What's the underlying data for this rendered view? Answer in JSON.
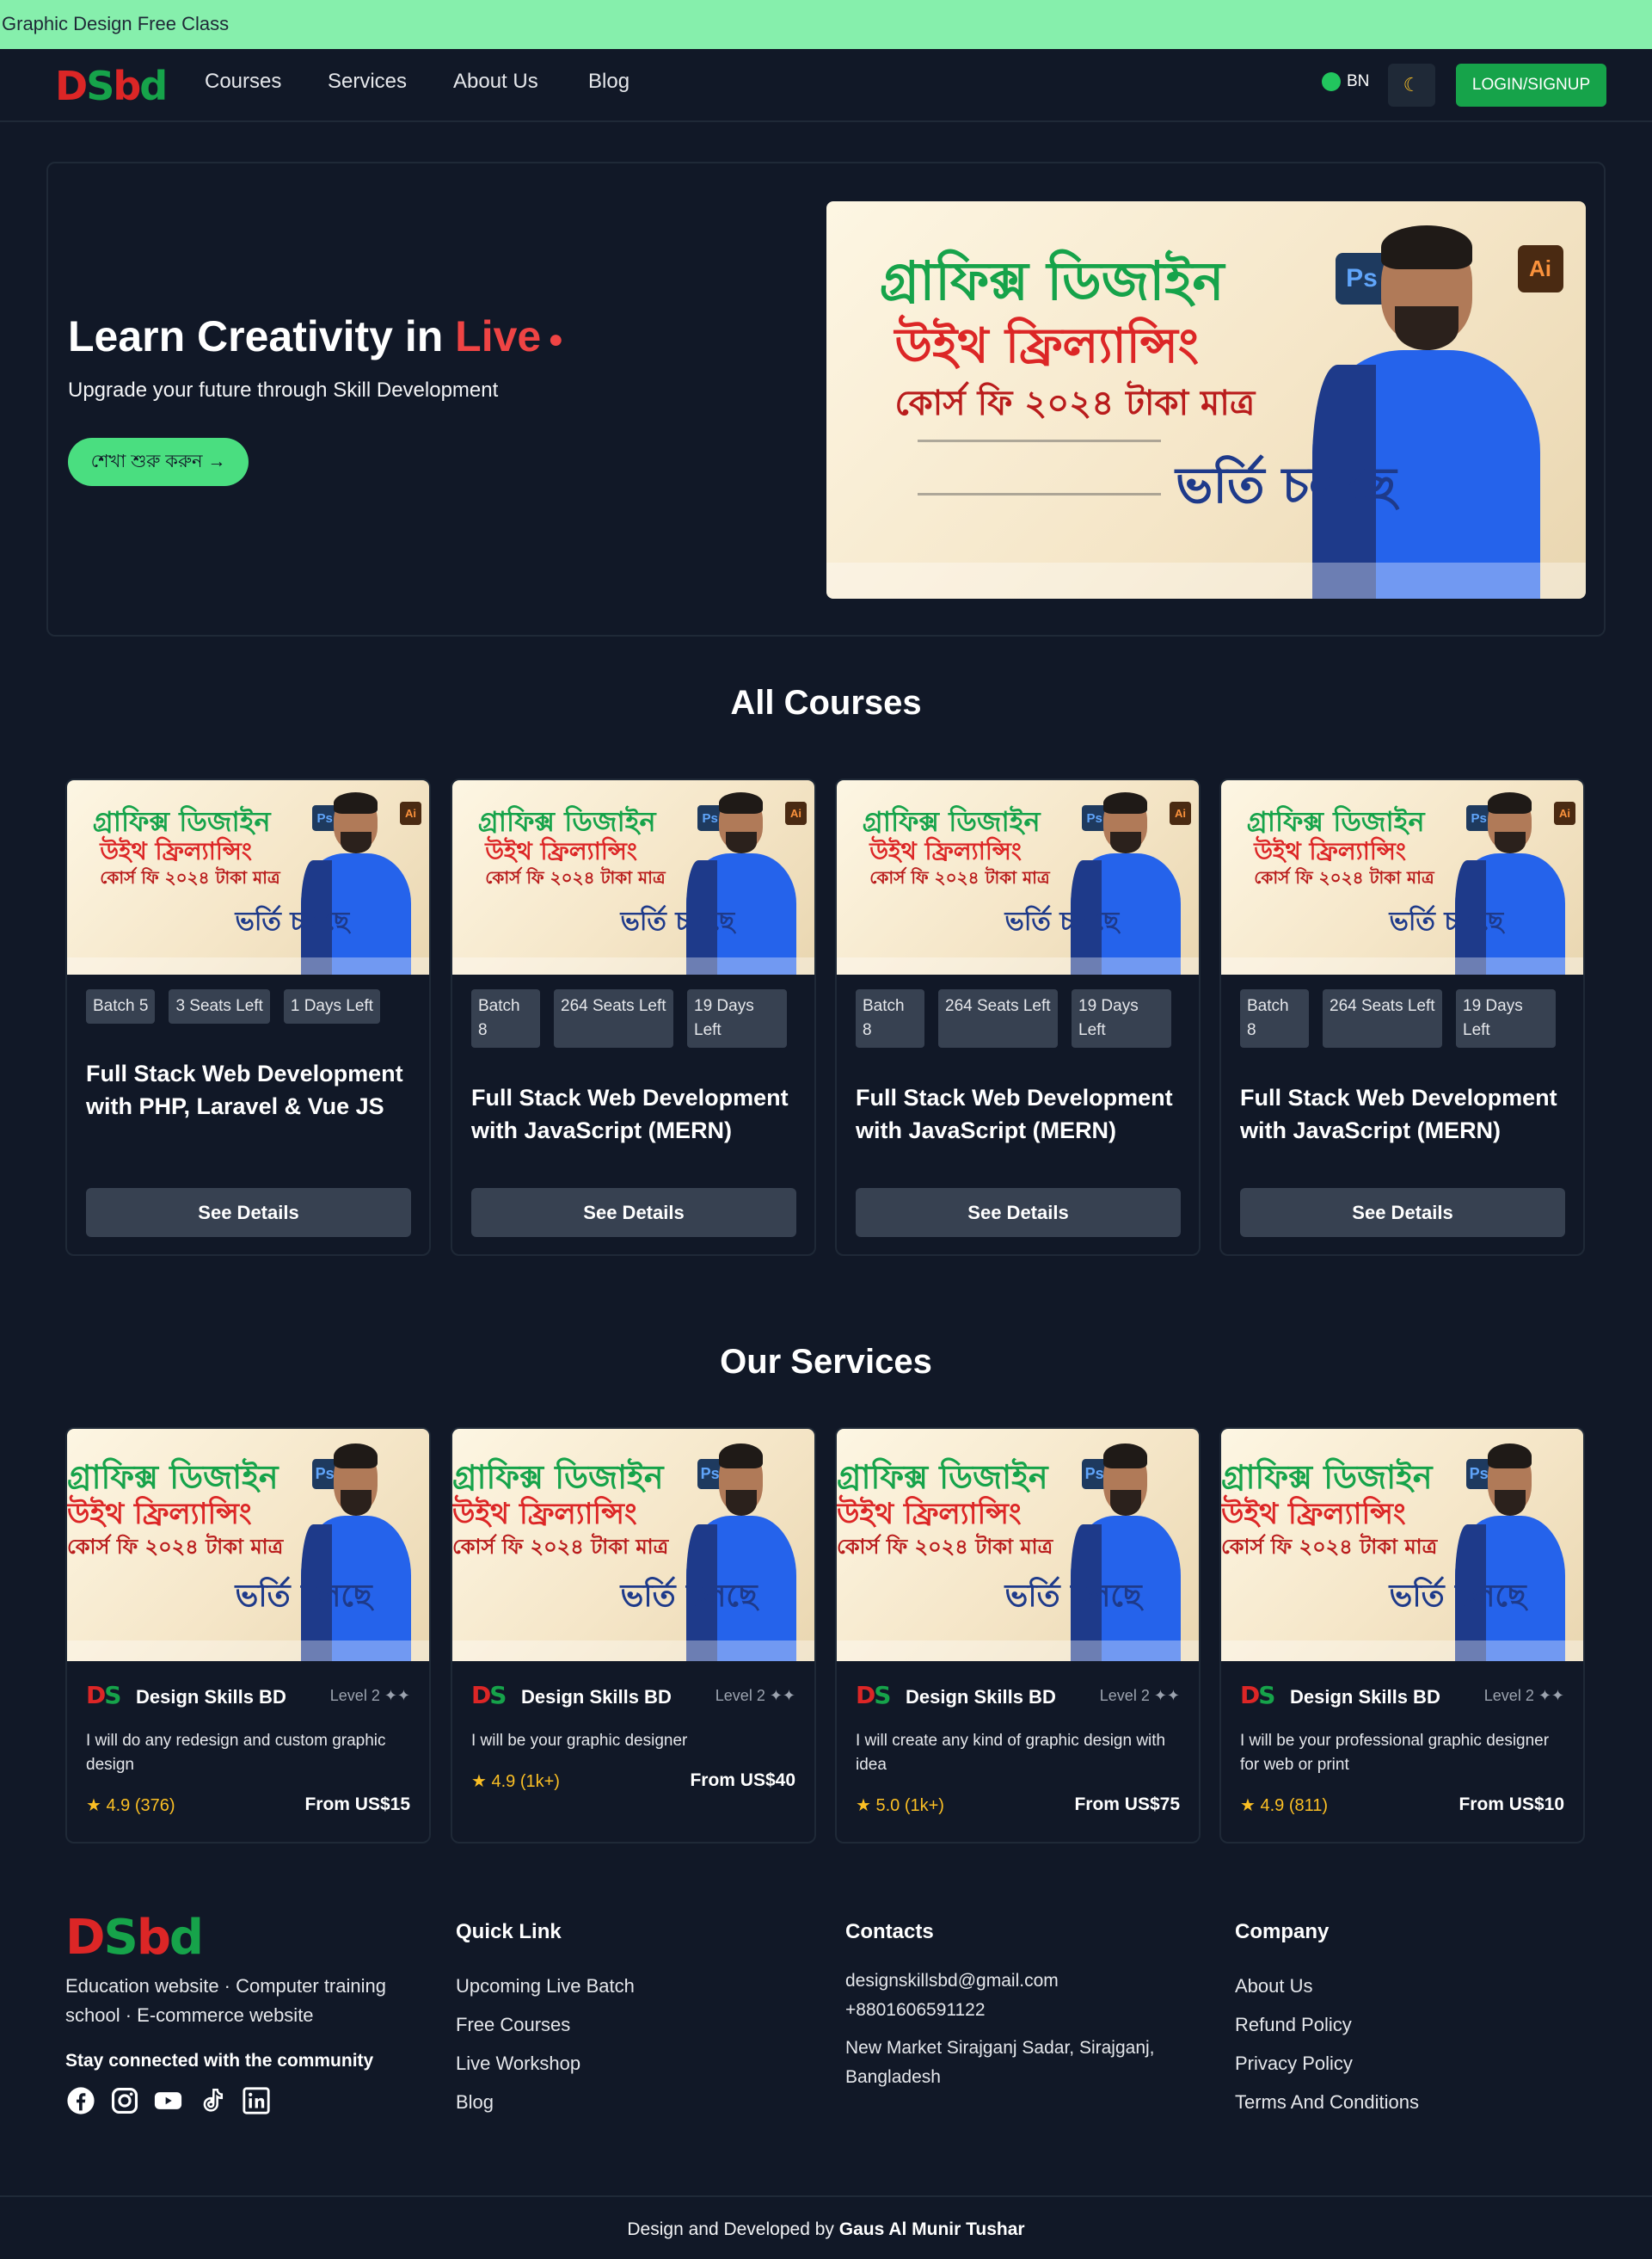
{
  "topbar": {
    "text": "Graphic Design Free Class"
  },
  "nav": {
    "logo": {
      "p1": "D",
      "p2": "S",
      "p3": "b",
      "p4": "d"
    },
    "links": [
      "Courses",
      "Services",
      "About Us",
      "Blog"
    ],
    "lang": "BN",
    "theme_icon": "moon-icon",
    "login": "LOGIN/SIGNUP"
  },
  "hero": {
    "title_prefix": "Learn Creativity in ",
    "title_live": "Live",
    "subtitle": "Upgrade your future through Skill Development",
    "cta": "শেখা শুরু করুন →"
  },
  "poster": {
    "line1": "গ্রাফিক্স ডিজাইন",
    "line2": "উইথ ফ্রিল্যান্সিং",
    "line3": "কোর্স ফি ২০২৪ টাকা মাত্র",
    "line4": "ভর্তি চলছে",
    "ps": "Ps",
    "ai": "Ai"
  },
  "courses_section": {
    "title": "All Courses",
    "cards": [
      {
        "badges": [
          "Batch 5",
          "3 Seats Left",
          "1 Days Left"
        ],
        "title": "Full Stack Web Development with PHP, Laravel & Vue JS",
        "button": "See Details"
      },
      {
        "badges": [
          "Batch 8",
          "264 Seats Left",
          "19 Days Left"
        ],
        "title": "Full Stack Web Development with JavaScript (MERN)",
        "button": "See Details"
      },
      {
        "badges": [
          "Batch 8",
          "264 Seats Left",
          "19 Days Left"
        ],
        "title": "Full Stack Web Development with JavaScript (MERN)",
        "button": "See Details"
      },
      {
        "badges": [
          "Batch 8",
          "264 Seats Left",
          "19 Days Left"
        ],
        "title": "Full Stack Web Development with JavaScript (MERN)",
        "button": "See Details"
      }
    ]
  },
  "services_section": {
    "title": "Our Services",
    "cards": [
      {
        "seller": "Design Skills BD",
        "level": "Level 2 ✦✦",
        "desc": "I will do any redesign and custom graphic design",
        "rating": "★ 4.9 (376)",
        "price": "From US$15"
      },
      {
        "seller": "Design Skills BD",
        "level": "Level 2 ✦✦",
        "desc": "I will be your graphic designer",
        "rating": "★ 4.9 (1k+)",
        "price": "From US$40"
      },
      {
        "seller": "Design Skills BD",
        "level": "Level 2 ✦✦",
        "desc": "I will create any kind of graphic design with idea",
        "rating": "★ 5.0 (1k+)",
        "price": "From US$75"
      },
      {
        "seller": "Design Skills BD",
        "level": "Level 2 ✦✦",
        "desc": "I will be your professional graphic designer for web or print",
        "rating": "★ 4.9 (811)",
        "price": "From US$10"
      }
    ]
  },
  "footer": {
    "tagline": "Education website · Computer training school · E-commerce website",
    "stay": "Stay connected with the community",
    "socials": [
      "facebook-icon",
      "instagram-icon",
      "youtube-icon",
      "tiktok-icon",
      "linkedin-icon"
    ],
    "quick_link": {
      "title": "Quick Link",
      "items": [
        "Upcoming Live Batch",
        "Free Courses",
        "Live Workshop",
        "Blog"
      ]
    },
    "contacts": {
      "title": "Contacts",
      "email": "designskillsbd@gmail.com",
      "phone": "+8801606591122",
      "address": "New Market Sirajganj Sadar, Sirajganj, Bangladesh"
    },
    "company": {
      "title": "Company",
      "items": [
        "About Us",
        "Refund Policy",
        "Privacy Policy",
        "Terms And Conditions"
      ]
    },
    "credit_prefix": "Design and Developed by ",
    "credit_name": "Gaus Al Munir Tushar"
  }
}
